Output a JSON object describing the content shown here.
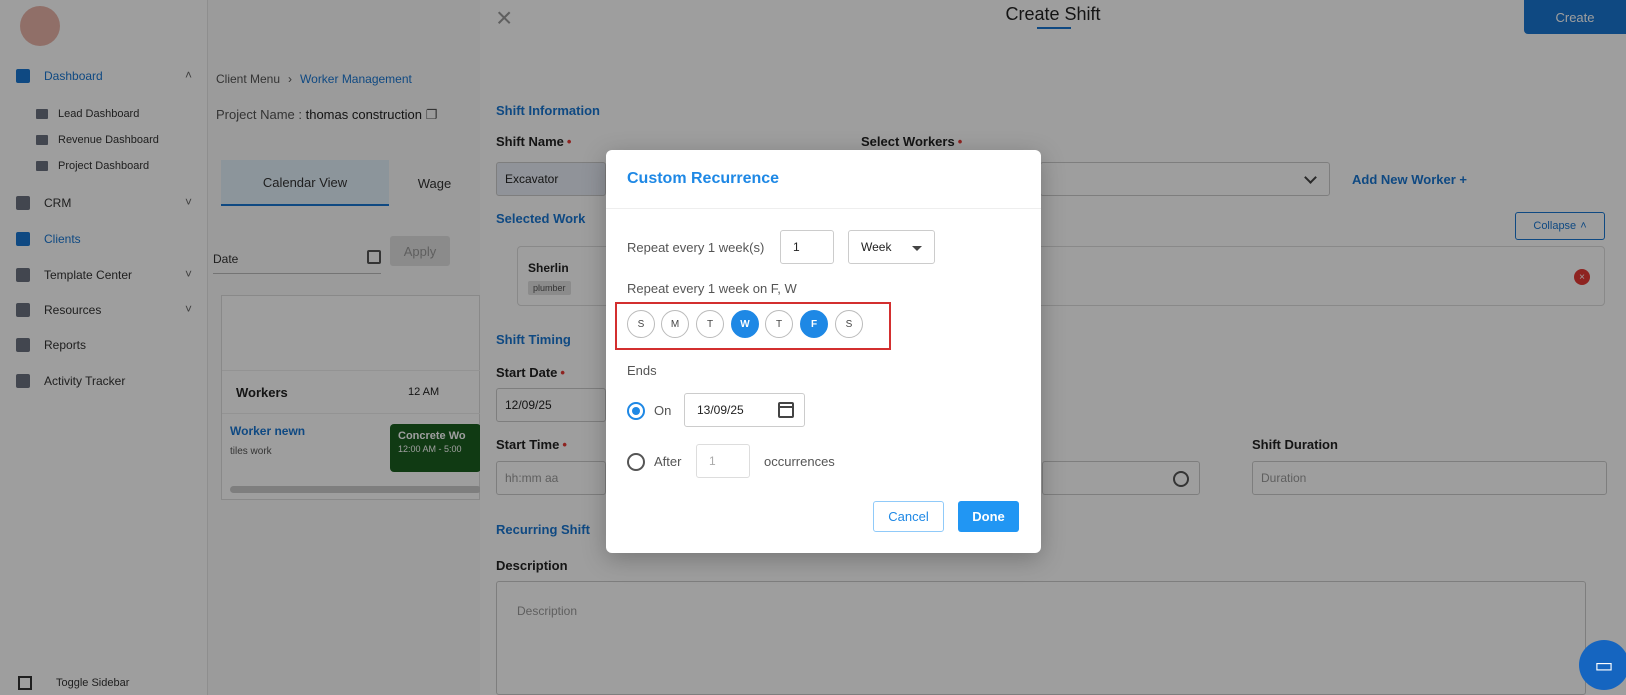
{
  "sidebar": {
    "items": [
      {
        "label": "Dashboard",
        "icon": "dashboard-icon",
        "active": true
      },
      {
        "label": "CRM",
        "icon": "crm-icon"
      },
      {
        "label": "Clients",
        "icon": "clients-icon",
        "active": true
      },
      {
        "label": "Template Center",
        "icon": "template-icon"
      },
      {
        "label": "Resources",
        "icon": "resources-icon"
      },
      {
        "label": "Reports",
        "icon": "reports-icon"
      },
      {
        "label": "Activity Tracker",
        "icon": "activity-icon"
      }
    ],
    "sub_items": [
      "Lead Dashboard",
      "Revenue Dashboard",
      "Project Dashboard"
    ],
    "toggle_label": "Toggle Sidebar"
  },
  "main": {
    "breadcrumb": {
      "root": "Client Menu",
      "current": "Worker Management"
    },
    "project_label": "Project Name :",
    "project_name": "thomas construction",
    "tabs": [
      "Calendar View",
      "Wage"
    ],
    "date_label": "Date",
    "apply_label": "Apply",
    "grid": {
      "workers_header": "Workers",
      "time_header": "12 AM",
      "worker_name": "Worker newn",
      "worker_role": "tiles work",
      "shift_title": "Concrete Wo",
      "shift_time": "12:00 AM - 5:00"
    }
  },
  "drawer": {
    "title": "Create Shift",
    "create_label": "Create",
    "close_icon": "close-icon",
    "shift_info_title": "Shift Information",
    "shift_name_label": "Shift Name",
    "shift_name_value": "Excavator",
    "select_workers_label": "Select Workers",
    "add_worker_label": "Add New Worker +",
    "selected_workers_title": "Selected Work",
    "collapse_label": "Collapse",
    "selected_worker": {
      "name": "Sherlin",
      "role": "plumber"
    },
    "shift_timing_title": "Shift Timing",
    "start_date_label": "Start Date",
    "start_date_value": "12/09/25",
    "start_time_label": "Start Time",
    "start_time_placeholder": "hh:mm aa",
    "shift_duration_label": "Shift Duration",
    "shift_duration_placeholder": "Duration",
    "recurring_title": "Recurring Shift",
    "description_label": "Description",
    "description_placeholder": "Description"
  },
  "modal": {
    "title": "Custom Recurrence",
    "repeat_label": "Repeat every 1 week(s)",
    "repeat_count": "1",
    "repeat_unit": "Week",
    "summary": "Repeat every 1 week on F, W",
    "days": [
      {
        "label": "S",
        "selected": false
      },
      {
        "label": "M",
        "selected": false
      },
      {
        "label": "T",
        "selected": false
      },
      {
        "label": "W",
        "selected": true
      },
      {
        "label": "T",
        "selected": false
      },
      {
        "label": "F",
        "selected": true
      },
      {
        "label": "S",
        "selected": false
      }
    ],
    "ends_label": "Ends",
    "on_label": "On",
    "on_date": "13/09/25",
    "after_label": "After",
    "after_placeholder": "1",
    "occurrences_label": "occurrences",
    "cancel_label": "Cancel",
    "done_label": "Done"
  },
  "colors": {
    "accent": "#1e88e5",
    "highlight_border": "#d32f2f"
  }
}
